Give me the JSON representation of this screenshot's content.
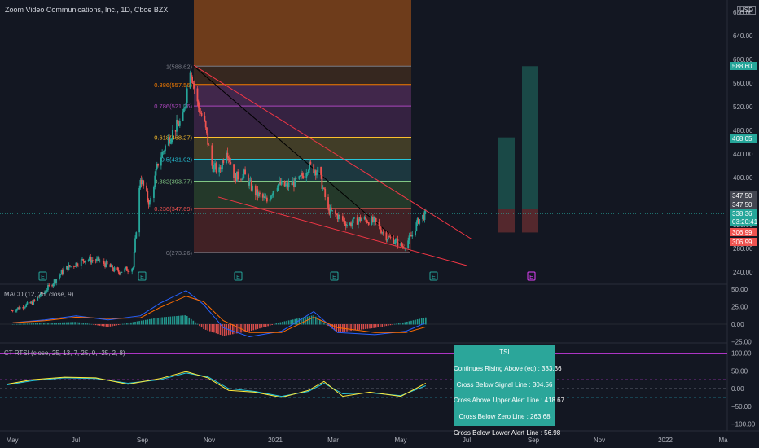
{
  "header": {
    "symbol_title": "Zoom Video Communications, Inc., 1D, Cboe BZX",
    "currency": "USD"
  },
  "price_axis": {
    "ticks": [
      "680.00",
      "640.00",
      "600.00",
      "560.00",
      "520.00",
      "480.00",
      "440.00",
      "400.00",
      "360.00",
      "320.00",
      "280.00",
      "240.00"
    ],
    "price_labels": [
      {
        "text": "588.60",
        "color": "#26a69a"
      },
      {
        "text": "468.05",
        "color": "#26a69a"
      },
      {
        "text": "347.50",
        "color": "#b2b5be"
      },
      {
        "text": "347.50",
        "color": "#b2b5be"
      },
      {
        "text": "338.36",
        "color": "#26a69a"
      },
      {
        "text": "03:20:41",
        "color": "#26a69a"
      },
      {
        "text": "306.99",
        "color": "#ef5350"
      },
      {
        "text": "306.99",
        "color": "#ef5350"
      }
    ]
  },
  "fib_labels": [
    {
      "text": "1(588.62)",
      "color": "#787b86"
    },
    {
      "text": "0.886(557.56)",
      "color": "#f57c00"
    },
    {
      "text": "0.786(521.26)",
      "color": "#ab47bc"
    },
    {
      "text": "0.618(468.27)",
      "color": "#fbc02d"
    },
    {
      "text": "0.5(431.02)",
      "color": "#26c6da"
    },
    {
      "text": "0.382(393.77)",
      "color": "#81c784"
    },
    {
      "text": "0.236(347.69)",
      "color": "#ef5350"
    },
    {
      "text": "0(273.26)",
      "color": "#787b86"
    }
  ],
  "earnings_markers": [
    "E",
    "E",
    "E",
    "E",
    "E",
    "E"
  ],
  "macd": {
    "title": "MACD (12, 26, close, 9)",
    "ticks": [
      "50.00",
      "25.00",
      "0.00",
      "−25.00"
    ]
  },
  "tsi": {
    "title": "CT RTSI (close, 25, 13, 7, 25, 0, -25, 2, 8)",
    "ticks": [
      "100.00",
      "50.00",
      "0.00",
      "−50.00",
      "−100.00"
    ],
    "alert_title": "TSI",
    "alerts": [
      "Continues Rising Above (eq) : 333.36",
      "Cross Below Signal Line : 304.56",
      "Cross Above Upper Alert Line : 418.67",
      "Cross Below Zero Line : 263.68",
      "Cross Below Lower Alert Line : 56.98"
    ]
  },
  "time_axis": [
    "May",
    "Jul",
    "Sep",
    "Nov",
    "2021",
    "Mar",
    "May",
    "Jul",
    "Sep",
    "Nov",
    "2022",
    "Ma"
  ],
  "colors": {
    "up": "#26a69a",
    "down": "#ef5350",
    "macd": "#2962ff",
    "signal": "#ff6d00",
    "tsi": "#ffeb3b",
    "tsi_signal": "#26c6da",
    "background": "#131722"
  },
  "chart_data": [
    {
      "type": "candlestick",
      "title": "Zoom Video Communications, Inc., 1D, Cboe BZX",
      "ylabel": "USD",
      "ylim": [
        220,
        690
      ],
      "x_range": [
        "2020-04-25",
        "2022-03-15"
      ],
      "fib_levels": [
        {
          "ratio": 1,
          "price": 588.62
        },
        {
          "ratio": 0.886,
          "price": 557.56
        },
        {
          "ratio": 0.786,
          "price": 521.26
        },
        {
          "ratio": 0.618,
          "price": 468.27
        },
        {
          "ratio": 0.5,
          "price": 431.02
        },
        {
          "ratio": 0.382,
          "price": 393.77
        },
        {
          "ratio": 0.236,
          "price": 347.69
        },
        {
          "ratio": 0,
          "price": 273.26
        }
      ],
      "price_path": [
        [
          "2020-04-30",
          175
        ],
        [
          "2020-05-20",
          188
        ],
        [
          "2020-06-05",
          215
        ],
        [
          "2020-06-20",
          245
        ],
        [
          "2020-07-10",
          262
        ],
        [
          "2020-07-25",
          258
        ],
        [
          "2020-08-10",
          240
        ],
        [
          "2020-08-25",
          248
        ],
        [
          "2020-09-01",
          400
        ],
        [
          "2020-09-10",
          355
        ],
        [
          "2020-09-18",
          425
        ],
        [
          "2020-09-28",
          465
        ],
        [
          "2020-10-05",
          485
        ],
        [
          "2020-10-12",
          500
        ],
        [
          "2020-10-19",
          588
        ],
        [
          "2020-10-26",
          525
        ],
        [
          "2020-11-02",
          490
        ],
        [
          "2020-11-09",
          420
        ],
        [
          "2020-11-16",
          410
        ],
        [
          "2020-11-23",
          450
        ],
        [
          "2020-12-01",
          400
        ],
        [
          "2020-12-10",
          405
        ],
        [
          "2020-12-20",
          375
        ],
        [
          "2021-01-01",
          360
        ],
        [
          "2021-01-10",
          390
        ],
        [
          "2021-01-20",
          385
        ],
        [
          "2021-02-01",
          395
        ],
        [
          "2021-02-10",
          420
        ],
        [
          "2021-02-20",
          410
        ],
        [
          "2021-03-01",
          345
        ],
        [
          "2021-03-10",
          335
        ],
        [
          "2021-03-20",
          320
        ],
        [
          "2021-04-01",
          330
        ],
        [
          "2021-04-15",
          325
        ],
        [
          "2021-04-26",
          300
        ],
        [
          "2021-05-05",
          292
        ],
        [
          "2021-05-12",
          283
        ],
        [
          "2021-05-20",
          300
        ],
        [
          "2021-05-27",
          328
        ],
        [
          "2021-06-03",
          338
        ]
      ]
    },
    {
      "type": "line",
      "title": "MACD (12, 26, close, 9)",
      "ylim": [
        -40,
        60
      ],
      "series": [
        {
          "values": [
            [
              "2020-05-01",
              2
            ],
            [
              "2020-06-01",
              6
            ],
            [
              "2020-07-01",
              12
            ],
            [
              "2020-08-01",
              6
            ],
            [
              "2020-09-01",
              12
            ],
            [
              "2020-09-20",
              30
            ],
            [
              "2020-10-15",
              48
            ],
            [
              "2020-11-01",
              28
            ],
            [
              "2020-11-20",
              -5
            ],
            [
              "2020-12-15",
              -18
            ],
            [
              "2021-01-15",
              -10
            ],
            [
              "2021-02-15",
              18
            ],
            [
              "2021-03-10",
              -12
            ],
            [
              "2021-04-15",
              -15
            ],
            [
              "2021-05-15",
              -10
            ],
            [
              "2021-06-03",
              2
            ]
          ]
        },
        {
          "values": [
            [
              "2020-05-01",
              2
            ],
            [
              "2020-06-01",
              5
            ],
            [
              "2020-07-01",
              10
            ],
            [
              "2020-08-01",
              8
            ],
            [
              "2020-09-01",
              9
            ],
            [
              "2020-09-20",
              24
            ],
            [
              "2020-10-15",
              40
            ],
            [
              "2020-11-01",
              32
            ],
            [
              "2020-11-20",
              5
            ],
            [
              "2020-12-15",
              -12
            ],
            [
              "2021-01-15",
              -12
            ],
            [
              "2021-02-15",
              10
            ],
            [
              "2021-03-10",
              -5
            ],
            [
              "2021-04-15",
              -12
            ],
            [
              "2021-05-15",
              -12
            ],
            [
              "2021-06-03",
              -4
            ]
          ]
        }
      ]
    },
    {
      "type": "line",
      "title": "CT RTSI (close, 25, 13, 7, 25, 0, -25, 2, 8)",
      "ylim": [
        -110,
        110
      ],
      "reference_lines": [
        100,
        25,
        0,
        -25,
        -100
      ],
      "series": [
        {
          "values": [
            [
              "2020-04-25",
              12
            ],
            [
              "2020-05-20",
              25
            ],
            [
              "2020-06-20",
              32
            ],
            [
              "2020-07-20",
              30
            ],
            [
              "2020-08-20",
              12
            ],
            [
              "2020-09-20",
              28
            ],
            [
              "2020-10-15",
              48
            ],
            [
              "2020-11-05",
              30
            ],
            [
              "2020-11-25",
              -5
            ],
            [
              "2020-12-20",
              -10
            ],
            [
              "2021-01-15",
              -25
            ],
            [
              "2021-02-10",
              -5
            ],
            [
              "2021-02-25",
              20
            ],
            [
              "2021-03-15",
              -22
            ],
            [
              "2021-04-10",
              -10
            ],
            [
              "2021-05-10",
              -22
            ],
            [
              "2021-06-03",
              15
            ]
          ]
        },
        {
          "values": [
            [
              "2020-04-25",
              10
            ],
            [
              "2020-05-20",
              22
            ],
            [
              "2020-06-20",
              30
            ],
            [
              "2020-07-20",
              28
            ],
            [
              "2020-08-20",
              15
            ],
            [
              "2020-09-20",
              25
            ],
            [
              "2020-10-15",
              44
            ],
            [
              "2020-11-05",
              33
            ],
            [
              "2020-11-25",
              0
            ],
            [
              "2020-12-20",
              -8
            ],
            [
              "2021-01-15",
              -22
            ],
            [
              "2021-02-10",
              -8
            ],
            [
              "2021-02-25",
              15
            ],
            [
              "2021-03-15",
              -15
            ],
            [
              "2021-04-10",
              -12
            ],
            [
              "2021-05-10",
              -20
            ],
            [
              "2021-06-03",
              8
            ]
          ]
        }
      ]
    }
  ]
}
